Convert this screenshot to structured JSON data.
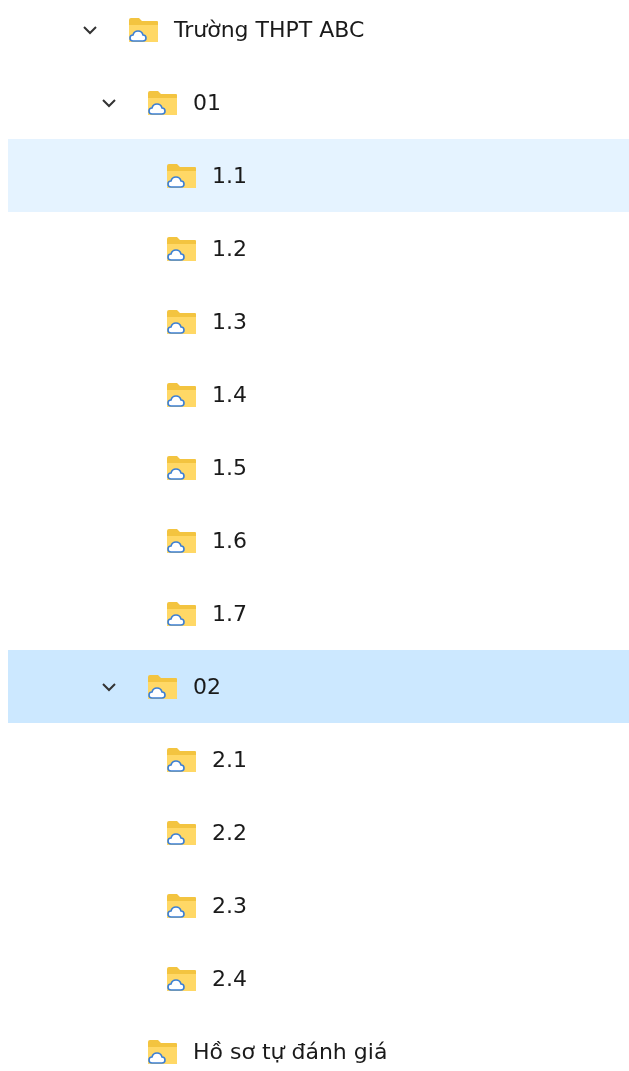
{
  "tree": [
    {
      "label": "Trường THPT ABC",
      "expanded": true,
      "selected": false,
      "hovered": false,
      "children": [
        {
          "label": "01",
          "expanded": true,
          "selected": false,
          "hovered": false,
          "children": [
            {
              "label": "1.1",
              "selected": false,
              "hovered": true
            },
            {
              "label": "1.2",
              "selected": false,
              "hovered": false
            },
            {
              "label": "1.3",
              "selected": false,
              "hovered": false
            },
            {
              "label": "1.4",
              "selected": false,
              "hovered": false
            },
            {
              "label": "1.5",
              "selected": false,
              "hovered": false
            },
            {
              "label": "1.6",
              "selected": false,
              "hovered": false
            },
            {
              "label": "1.7",
              "selected": false,
              "hovered": false
            }
          ]
        },
        {
          "label": "02",
          "expanded": true,
          "selected": true,
          "hovered": false,
          "children": [
            {
              "label": "2.1",
              "selected": false,
              "hovered": false
            },
            {
              "label": "2.2",
              "selected": false,
              "hovered": false
            },
            {
              "label": "2.3",
              "selected": false,
              "hovered": false
            },
            {
              "label": "2.4",
              "selected": false,
              "hovered": false
            }
          ]
        },
        {
          "label": "Hồ sơ tự đánh giá",
          "selected": false,
          "hovered": false
        }
      ]
    }
  ]
}
